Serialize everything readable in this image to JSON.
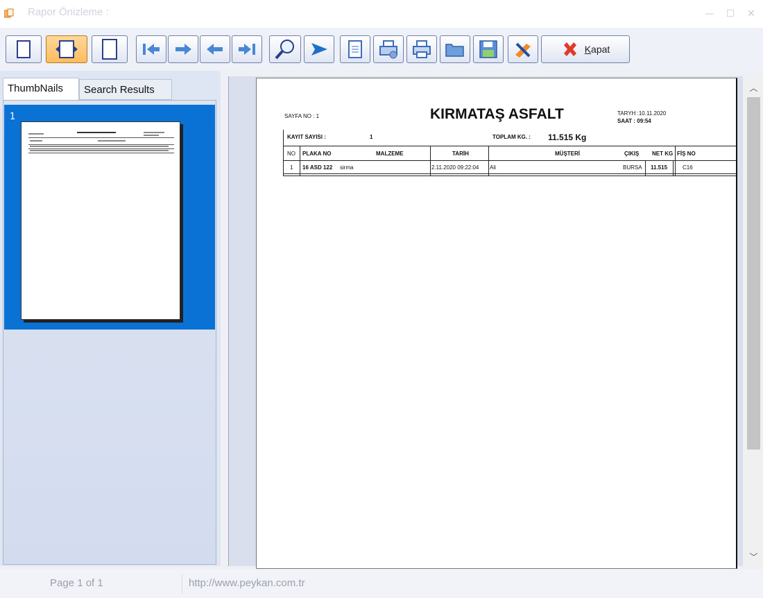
{
  "window": {
    "title": "Rapor Önizleme :"
  },
  "toolbar": {
    "close_label": "Kapat"
  },
  "tabs": [
    {
      "label": "ThumbNails"
    },
    {
      "label": "Search Results"
    }
  ],
  "thumbnails": [
    {
      "page_number": "1"
    }
  ],
  "report": {
    "page_label": "SAYFA NO : 1",
    "title": "KIRMATAŞ ASFALT",
    "date_label": "TARYH :10.11.2020",
    "time_label": "SAAT : 09:54",
    "record_count_label": "KAYIT SAYISI :",
    "record_count_value": "1",
    "total_label": "TOPLAM KG. :",
    "total_value": "11.515 Kg",
    "columns": [
      "NO",
      "PLAKA NO",
      "MALZEME",
      "TARİH",
      "MÜŞTERİ",
      "ÇIKIŞ",
      "NET KG",
      "FİŞ NO"
    ],
    "rows": [
      [
        "1",
        "16 ASD 122",
        "sirma",
        "2.11.2020 09:22:04",
        "Ali",
        "BURSA",
        "11.515",
        "C16"
      ]
    ]
  },
  "statusbar": {
    "page": "Page 1 of 1",
    "url": "http://www.peykan.com.tr"
  }
}
